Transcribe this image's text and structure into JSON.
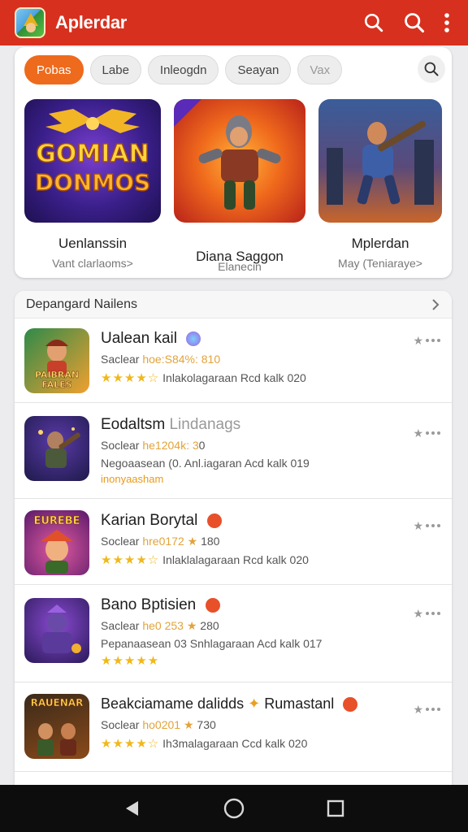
{
  "appbar": {
    "title": "Aplerdar",
    "bg": "#d8301e",
    "icons": [
      "search-icon",
      "search-icon",
      "more-vert-icon"
    ]
  },
  "chips": [
    {
      "label": "Pobas",
      "active": true
    },
    {
      "label": "Labe",
      "active": false
    },
    {
      "label": "Inleogdn",
      "active": false
    },
    {
      "label": "Seayan",
      "active": false
    },
    {
      "label": "Vax",
      "active": false
    }
  ],
  "featured": [
    {
      "art_text_1": "GOMIAN",
      "art_text_2": "DONMOS",
      "name": "Uenlanssin",
      "sub": "Vant clarlaoms>"
    },
    {
      "name": "Diana Saggon",
      "sub": "Elanecin"
    },
    {
      "name": "Mplerdan",
      "sub": "May (Teniaraye>"
    }
  ],
  "list": {
    "header": "Depangard Nailens",
    "rows": [
      {
        "name": "Ualean kail",
        "name_muted": "",
        "meta_prefix": "Saclear",
        "meta_highlight": "hoe:S84%: 810",
        "line2_stars": "★★★★☆",
        "line2_text": "Inlakolagaraan Rcd kalk 020",
        "line3": "",
        "icon_art_text": "PAIBRAN FALES"
      },
      {
        "name": "Eodaltsm",
        "name_muted": "Lindanags",
        "meta_prefix": "Soclear",
        "meta_highlight": "he1204k: 3",
        "meta_suffix": "0",
        "line2_stars": "",
        "line2_text": "Negoaasean (0. Anl.iagaran Acd kalk 019",
        "line3": "inonyaasham",
        "icon_art_text": ""
      },
      {
        "name": "Karian Borytal",
        "name_muted": "",
        "meta_prefix": "Soclear",
        "meta_highlight": "hre0172 ★",
        "meta_suffix": "180",
        "line2_stars": "★★★★☆",
        "line2_text": "Inlaklalagaraan Rcd kalk 020",
        "line3": "",
        "icon_art_text": "EUREBE"
      },
      {
        "name": "Bano Bptisien",
        "name_muted": "",
        "meta_prefix": "Saclear",
        "meta_highlight": "he0 253 ★",
        "meta_suffix": "280",
        "line2_stars": "",
        "line2_text": "Pepanaasean 03 Snhlagaraan Acd kalk 017",
        "line3_stars": "★★★★★",
        "icon_art_text": ""
      },
      {
        "name": "Beakciamame dalidds",
        "name_suffix": "Rumastanl",
        "meta_prefix": "Soclear",
        "meta_highlight": "ho0201 ★",
        "meta_suffix": "730",
        "line2_stars": "★★★★☆",
        "line2_text": "Ih3malagaraan Ccd kalk 020",
        "line3": "",
        "icon_art_text": "RAUENAR"
      }
    ]
  },
  "nav": [
    "back-icon",
    "home-icon",
    "recents-icon"
  ]
}
